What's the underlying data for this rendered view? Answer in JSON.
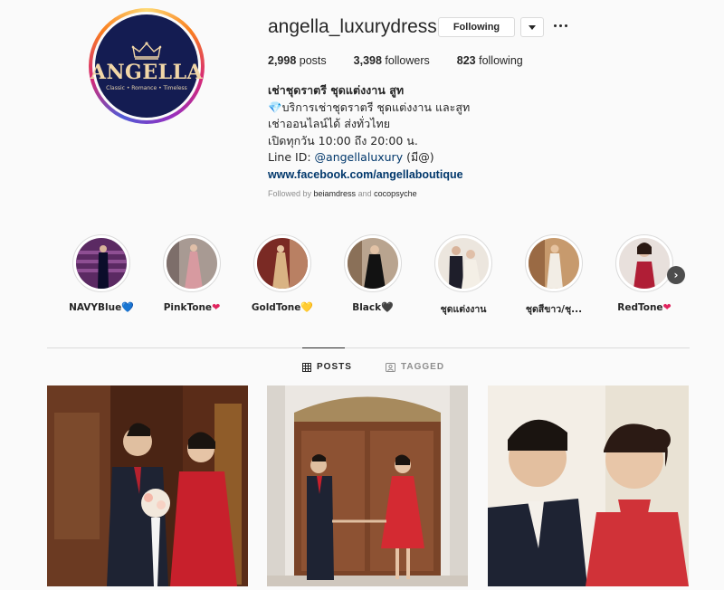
{
  "profile": {
    "username": "angella_luxurydress",
    "avatar_brand": "ANGELLA",
    "avatar_tagline": "Classic • Romance • Timeless",
    "following_button": "Following",
    "stats": {
      "posts_count": "2,998",
      "posts_label": "posts",
      "followers_count": "3,398",
      "followers_label": "followers",
      "following_count": "823",
      "following_label": "following"
    },
    "bio": {
      "full_name": "เช่าชุดราตรี ชุดแต่งงาน สูท",
      "line1": "💎บริการเช่าชุดราตรี ชุดแต่งงาน และสูท",
      "line2": "เช่าออนไลน์ได้ ส่งทั่วไทย",
      "line3": "เปิดทุกวัน 10:00 ถึง 20:00 น.",
      "line_id_prefix": "Line ID: ",
      "line_id_handle": "@angellaluxury",
      "line_id_suffix": " (มี@)",
      "website": "www.facebook.com/angellaboutique"
    },
    "followed_by": {
      "prefix": "Followed by ",
      "user1": "beiamdress",
      "joiner": " and ",
      "user2": "cocopsyche"
    }
  },
  "highlights": [
    {
      "label": "NAVYBlue",
      "heart": "💙",
      "heart_color": "#1e90ff"
    },
    {
      "label": "PinkTone",
      "heart": "❤",
      "heart_color": "#e0245e"
    },
    {
      "label": "GoldTone",
      "heart": "💛",
      "heart_color": "#f5b400"
    },
    {
      "label": "Black",
      "heart": "🖤",
      "heart_color": "#262626"
    },
    {
      "label": "ชุดแต่งงาน",
      "heart": "",
      "heart_color": "#262626"
    },
    {
      "label": "ชุดสีขาว/ชุ...",
      "heart": "",
      "heart_color": "#262626"
    },
    {
      "label": "RedTone",
      "heart": "❤",
      "heart_color": "#e0245e"
    }
  ],
  "tabs": {
    "posts": "POSTS",
    "tagged": "TAGGED"
  },
  "icons": {
    "next": "chevron-right-icon",
    "more": "more-options-icon",
    "dropdown": "chevron-down-icon",
    "posts_tab": "grid-icon",
    "tagged_tab": "tag-icon"
  }
}
